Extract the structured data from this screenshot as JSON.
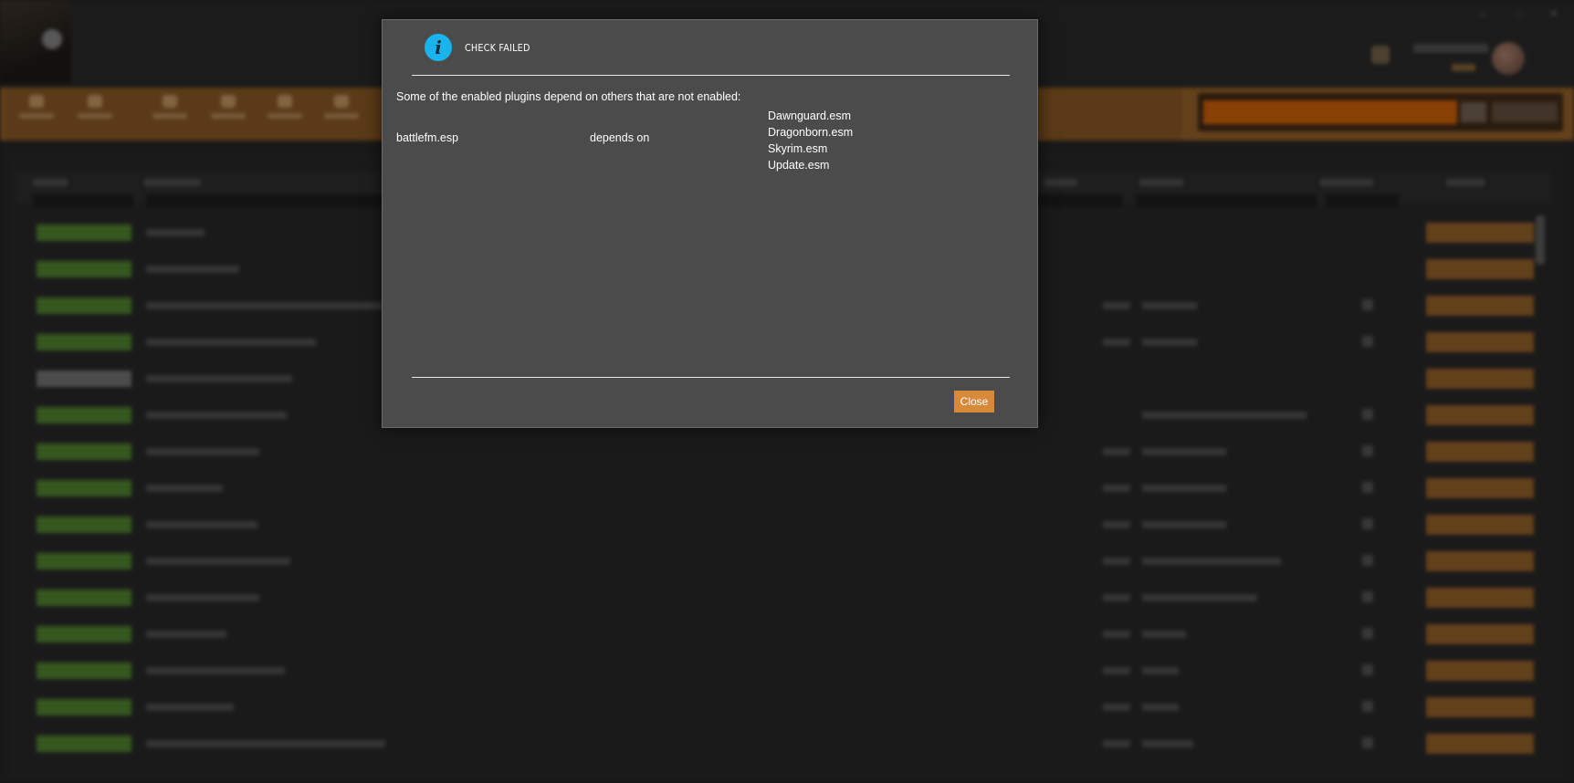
{
  "dialog": {
    "title": "CHECK FAILED",
    "info_icon_glyph": "i",
    "message": "Some of the enabled plugins depend on others that are not enabled:",
    "plugin": "battlefm.esp",
    "relation": "depends on",
    "dependencies": [
      "Dawnguard.esm",
      "Dragonborn.esm",
      "Skyrim.esm",
      "Update.esm"
    ],
    "close_label": "Close"
  },
  "colors": {
    "accent": "#d9893a",
    "info_icon": "#19b4ee",
    "dialog_bg": "#4b4b4b",
    "toolbar": "#8a5a26",
    "enabled_badge": "#4b7a2c"
  }
}
